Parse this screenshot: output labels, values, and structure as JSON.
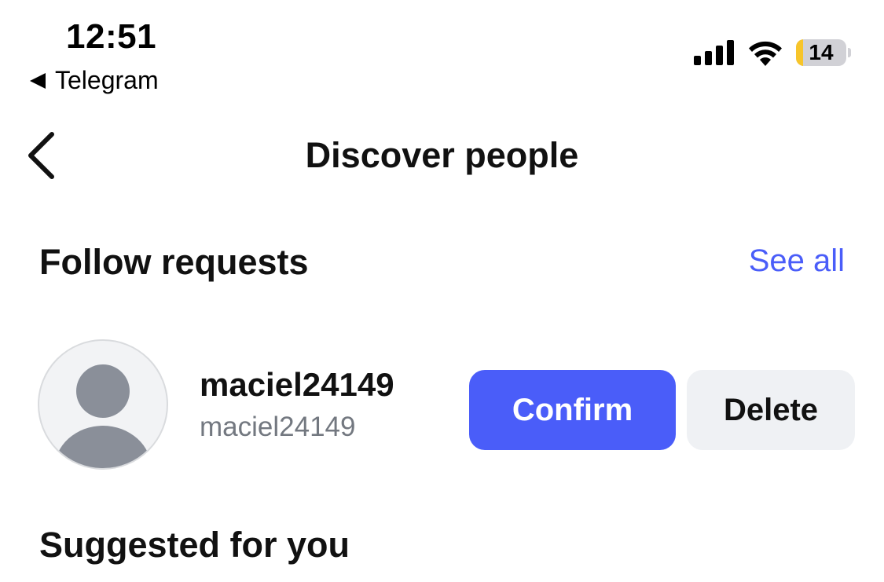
{
  "status_bar": {
    "time": "12:51",
    "back_app_label": "Telegram",
    "battery_level": "14",
    "battery_color": "#f7c52a"
  },
  "header": {
    "title": "Discover people"
  },
  "follow_requests": {
    "title": "Follow requests",
    "see_all_label": "See all",
    "items": [
      {
        "username": "maciel24149",
        "handle": "maciel24149",
        "confirm_label": "Confirm",
        "delete_label": "Delete"
      }
    ]
  },
  "suggested": {
    "title": "Suggested for you"
  },
  "colors": {
    "accent": "#4a5df9",
    "secondary_button": "#eff1f4"
  },
  "icons": {
    "back": "chevron-left-icon",
    "signal": "signal-icon",
    "wifi": "wifi-icon",
    "battery": "battery-icon",
    "avatar": "default-avatar-icon"
  }
}
